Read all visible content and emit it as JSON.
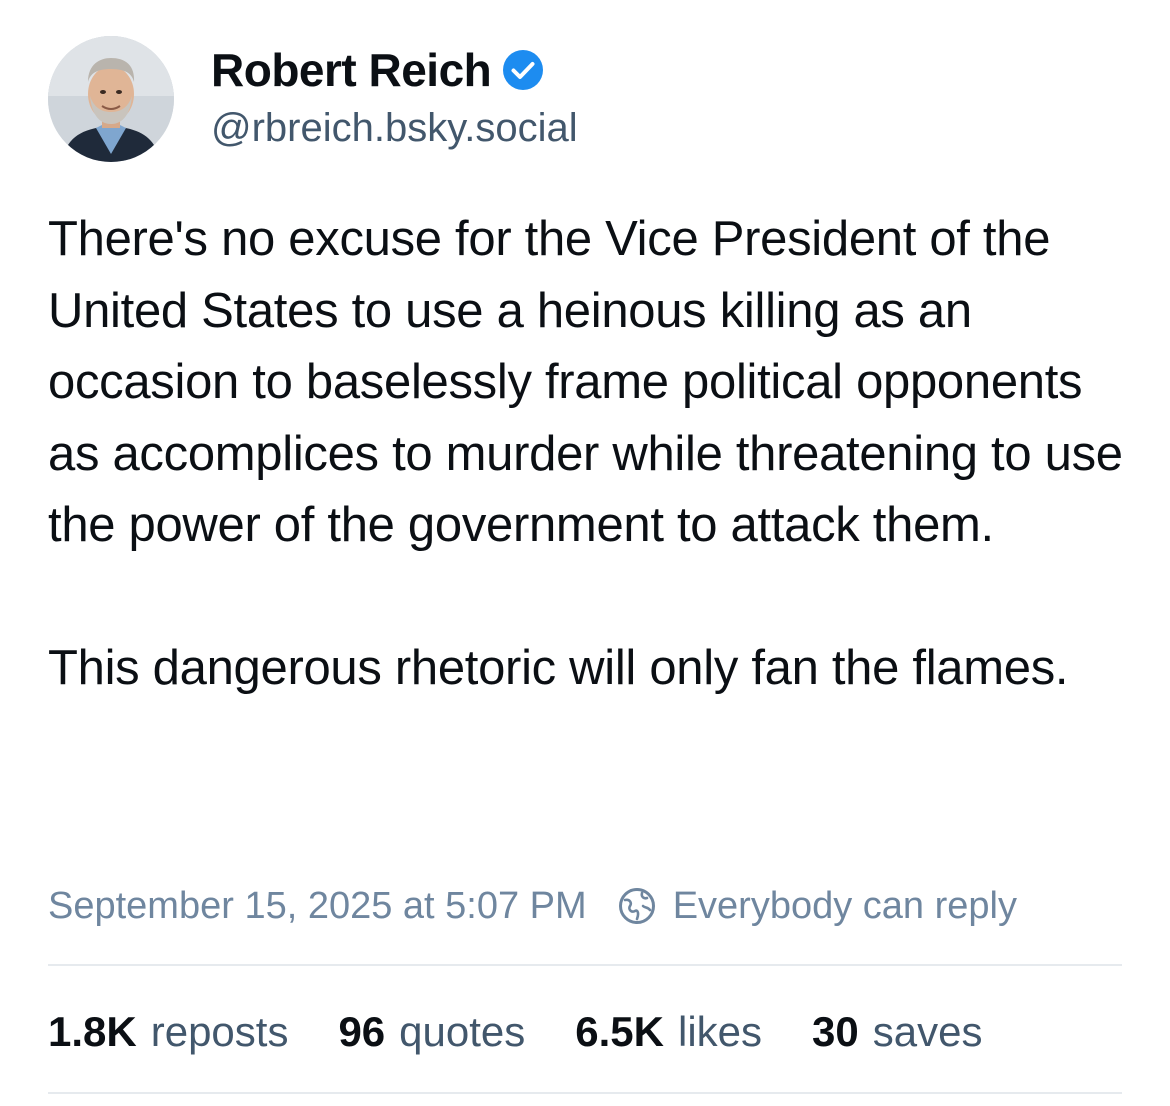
{
  "author": {
    "name": "Robert Reich",
    "handle": "@rbreich.bsky.social",
    "verified": true,
    "verified_color": "#1d8cf0"
  },
  "post": {
    "paragraphs": [
      "There's no excuse for the Vice President of the United States to use a heinous killing as an occasion to baselessly frame political opponents as accomplices to murder while threatening to use the power of the government to attack them.",
      "This dangerous rhetoric will only fan the flames."
    ]
  },
  "meta": {
    "timestamp": "September 15, 2025 at 5:07 PM",
    "reply_setting": "Everybody can reply",
    "reply_icon": "globe-icon"
  },
  "stats": {
    "reposts": {
      "count": "1.8K",
      "label": "reposts"
    },
    "quotes": {
      "count": "96",
      "label": "quotes"
    },
    "likes": {
      "count": "6.5K",
      "label": "likes"
    },
    "saves": {
      "count": "30",
      "label": "saves"
    }
  },
  "colors": {
    "text_primary": "#0b0f14",
    "text_secondary": "#42576c",
    "text_meta": "#6f869f",
    "divider": "#e6eaee"
  }
}
